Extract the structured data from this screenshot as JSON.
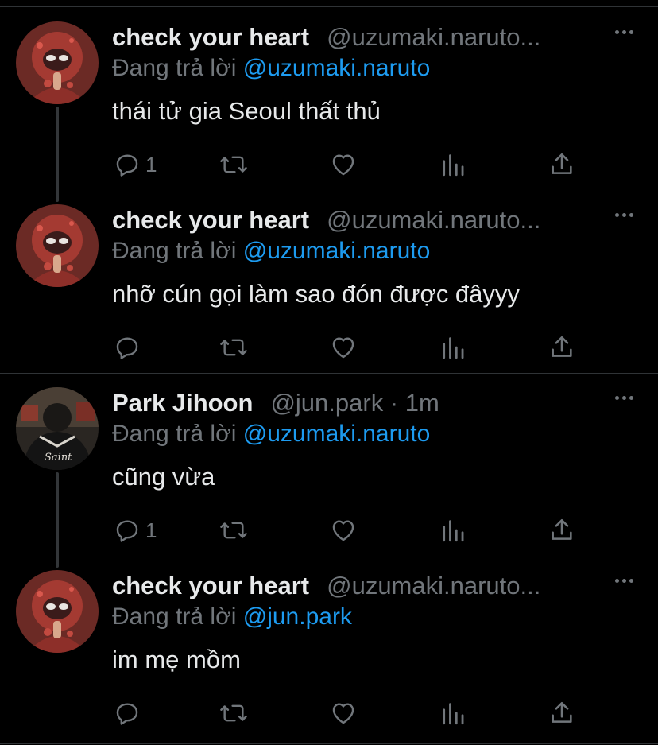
{
  "reply_prefix": "Đang trả lời",
  "colors": {
    "background": "#000000",
    "text": "#e7e9ea",
    "muted": "#71767b",
    "link": "#1d9bf0",
    "divider": "#2f3336"
  },
  "tweets": [
    {
      "name": "check your heart",
      "handle": "@uzumaki.naruto...",
      "replying_to": "@uzumaki.naruto",
      "text": "thái tử gia Seoul thất thủ",
      "reply_count": "1",
      "avatar": "red-hooded-figure"
    },
    {
      "name": "check your heart",
      "handle": "@uzumaki.naruto...",
      "replying_to": "@uzumaki.naruto",
      "text": "nhỡ cún gọi làm sao đón được đâyyy",
      "reply_count": "",
      "avatar": "red-hooded-figure"
    },
    {
      "name": "Park Jihoon",
      "handle": "@jun.park · 1m",
      "replying_to": "@uzumaki.naruto",
      "text": "cũng vừa",
      "reply_count": "1",
      "avatar": "dark-jacket-figure"
    },
    {
      "name": "check your heart",
      "handle": "@uzumaki.naruto...",
      "replying_to": "@jun.park",
      "text": "im mẹ mồm",
      "reply_count": "",
      "avatar": "red-hooded-figure"
    }
  ]
}
